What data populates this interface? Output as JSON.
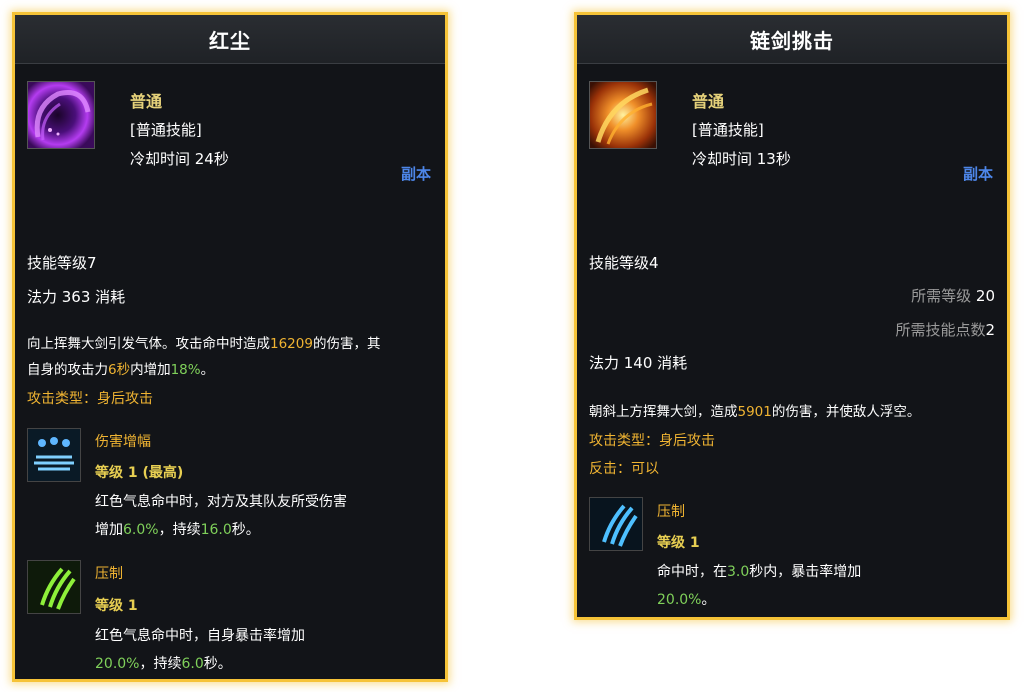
{
  "card1": {
    "title": "红尘",
    "grade": "普通",
    "skill_type": "[普通技能]",
    "cooldown": "冷却时间 24秒",
    "dungeon": "副本",
    "skill_level": "技能等级7",
    "mana": "法力 363 消耗",
    "desc": {
      "p1": "向上挥舞大剑引发气体。攻击命中时造成",
      "n1": "16209",
      "p2": "的伤害，其",
      "p3": "自身的攻击力",
      "n2": "6秒",
      "p4": "内增加",
      "n3": "18%",
      "p5": "。"
    },
    "attack_type": "攻击类型：身后攻击",
    "sub1": {
      "icon": "damage-boost-icon",
      "name": "伤害增幅",
      "level": "等级 1 (最高)",
      "line1": "红色气息命中时，对方及其队友所受伤害",
      "line2a": "增加",
      "n1": "6.0%",
      "line2b": "，持续",
      "n2": "16.0",
      "line2c": "秒。"
    },
    "sub2": {
      "icon": "suppress-claw-icon",
      "name": "压制",
      "level": "等级 1",
      "line1": "红色气息命中时，自身暴击率增加",
      "n1": "20.0%",
      "line2b": "，持续",
      "n2": "6.0",
      "line2c": "秒。"
    }
  },
  "card2": {
    "title": "链剑挑击",
    "grade": "普通",
    "skill_type": "[普通技能]",
    "cooldown": "冷却时间 13秒",
    "dungeon": "副本",
    "skill_level": "技能等级4",
    "req_level_label": "所需等级",
    "req_level_value": "20",
    "req_points_label": "所需技能点数",
    "req_points_value": "2",
    "mana": "法力 140 消耗",
    "desc": {
      "p1": "朝斜上方挥舞大剑，造成",
      "n1": "5901",
      "p2": "的伤害，并使敌人浮空。"
    },
    "attack_type": "攻击类型：身后攻击",
    "counter": "反击：可以",
    "sub1": {
      "icon": "suppress-claw-icon",
      "name": "压制",
      "level": "等级 1",
      "line1a": "命中时，在",
      "n1": "3.0",
      "line1b": "秒内，暴击率增加",
      "n2": "20.0%",
      "line2b": "。"
    }
  },
  "colors": {
    "border": "#f6c338",
    "highlight_yellow": "#f0b432",
    "highlight_green": "#7fd05a",
    "dungeon_blue": "#4d86e8"
  }
}
